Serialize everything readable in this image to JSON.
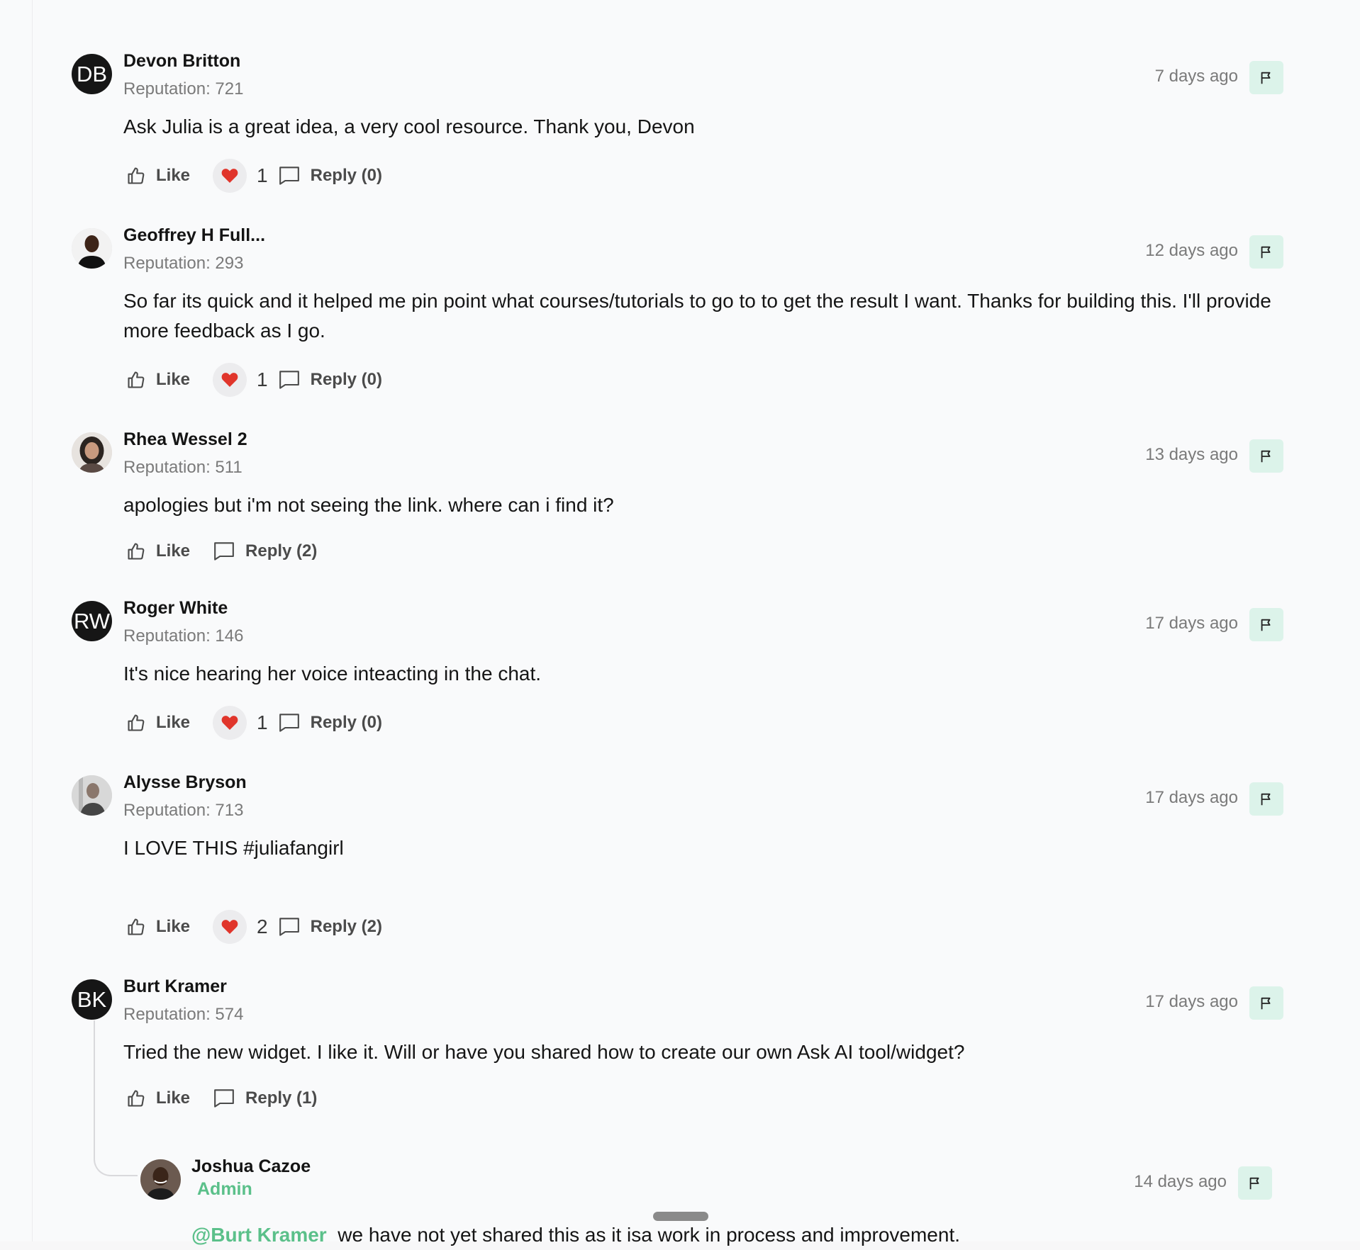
{
  "comments": [
    {
      "initials": "DB",
      "name": "Devon Britton",
      "reputation": "Reputation: 721",
      "time": "7 days ago",
      "text": "Ask Julia is a great idea, a very cool resource. Thank you, Devon",
      "like_label": "Like",
      "reaction_count": "1",
      "reply_label": "Reply (0)"
    },
    {
      "initials": "",
      "name": "Geoffrey H Full...",
      "reputation": "Reputation: 293",
      "time": "12 days ago",
      "text": "So far its quick and it helped me pin point what courses/tutorials to go to to get the result I want. Thanks for building this. I'll provide more feedback as I go.",
      "like_label": "Like",
      "reaction_count": "1",
      "reply_label": "Reply (0)"
    },
    {
      "initials": "",
      "name": "Rhea Wessel 2",
      "reputation": "Reputation: 511",
      "time": "13 days ago",
      "text": "apologies but i'm not seeing the link. where can i find it?",
      "like_label": "Like",
      "reply_label": "Reply (2)"
    },
    {
      "initials": "RW",
      "name": "Roger White",
      "reputation": "Reputation: 146",
      "time": "17 days ago",
      "text": "It's nice hearing her voice inteacting in the chat.",
      "like_label": "Like",
      "reaction_count": "1",
      "reply_label": "Reply (0)"
    },
    {
      "initials": "",
      "name": "Alysse Bryson",
      "reputation": "Reputation: 713",
      "time": "17 days ago",
      "text": "I LOVE THIS #juliafangirl",
      "like_label": "Like",
      "reaction_count": "2",
      "reply_label": "Reply (2)"
    },
    {
      "initials": "BK",
      "name": "Burt Kramer",
      "reputation": "Reputation: 574",
      "time": "17 days ago",
      "text": "Tried the new widget. I like it. Will or have you shared how to create our own Ask AI tool/widget?",
      "like_label": "Like",
      "reply_label": "Reply (1)"
    }
  ],
  "reply": {
    "name": "Joshua Cazoe",
    "role": "Admin",
    "time": "14 days ago",
    "mention": "@Burt Kramer",
    "text": "we have not yet shared this as it isa work in process and improvement."
  },
  "colors": {
    "accent_green": "#5bc08a",
    "flag_bg": "#dcf3ea",
    "page_bg": "#f9fafb"
  },
  "icons": [
    "thumbs-up-icon",
    "heart-icon",
    "comment-bubble-icon",
    "flag-icon"
  ]
}
